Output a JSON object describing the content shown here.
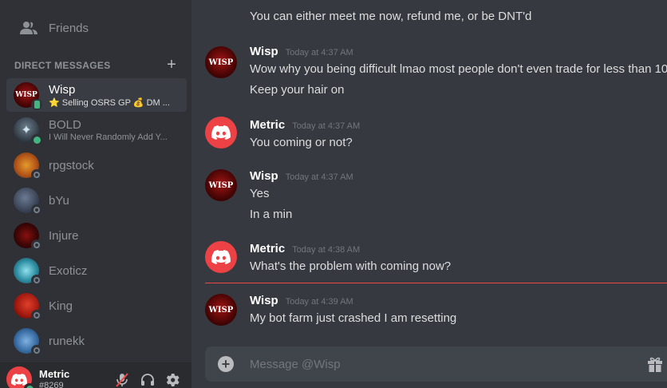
{
  "sidebar": {
    "friends_label": "Friends",
    "dm_header": "DIRECT MESSAGES",
    "dm_add": "+",
    "items": [
      {
        "name": "Wisp",
        "sub": "⭐ Selling OSRS GP 💰 DM ...",
        "status": "mobile",
        "avatar": "wisp"
      },
      {
        "name": "BOLD",
        "sub": "I Will Never Randomly Add Y...",
        "status": "online",
        "avatar": "bold"
      },
      {
        "name": "rpgstock",
        "sub": "",
        "status": "offline",
        "avatar": "rpgstock"
      },
      {
        "name": "bYu",
        "sub": "",
        "status": "offline",
        "avatar": "byu"
      },
      {
        "name": "Injure",
        "sub": "",
        "status": "offline",
        "avatar": "injure"
      },
      {
        "name": "Exoticz",
        "sub": "",
        "status": "offline",
        "avatar": "exoticz"
      },
      {
        "name": "King",
        "sub": "",
        "status": "offline",
        "avatar": "king"
      },
      {
        "name": "runekk",
        "sub": "",
        "status": "offline",
        "avatar": "runekk"
      }
    ]
  },
  "user_panel": {
    "name": "Metric",
    "tag": "#8269"
  },
  "chat": {
    "top_line": "You can either meet me now, refund me, or be DNT'd",
    "groups": [
      {
        "author": "Wisp",
        "time": "Today at 4:37 AM",
        "avatar": "wisp",
        "lines": [
          "Wow why you being difficult lmao most people don't even trade for less than 10",
          "Keep your hair on"
        ]
      },
      {
        "author": "Metric",
        "time": "Today at 4:37 AM",
        "avatar": "discord",
        "lines": [
          "You coming or not?"
        ]
      },
      {
        "author": "Wisp",
        "time": "Today at 4:37 AM",
        "avatar": "wisp",
        "lines": [
          "Yes",
          "In a min"
        ]
      },
      {
        "author": "Metric",
        "time": "Today at 4:38 AM",
        "avatar": "discord",
        "lines": [
          "What's the problem with coming now?"
        ]
      },
      {
        "author": "Wisp",
        "time": "Today at 4:39 AM",
        "avatar": "wisp",
        "lines": [
          "My bot farm just crashed I am resetting"
        ]
      }
    ],
    "composer_placeholder": "Message @Wisp"
  },
  "colors": {
    "discord_red": "#ed4245",
    "new_messages_divider": "#f04747",
    "online": "#43b581",
    "offline": "#747f8d"
  },
  "icons": [
    "friends-icon",
    "plus-icon",
    "discord-logo-icon",
    "mute-mic-icon",
    "headphones-icon",
    "gear-icon",
    "add-attachment-icon",
    "gift-icon"
  ]
}
